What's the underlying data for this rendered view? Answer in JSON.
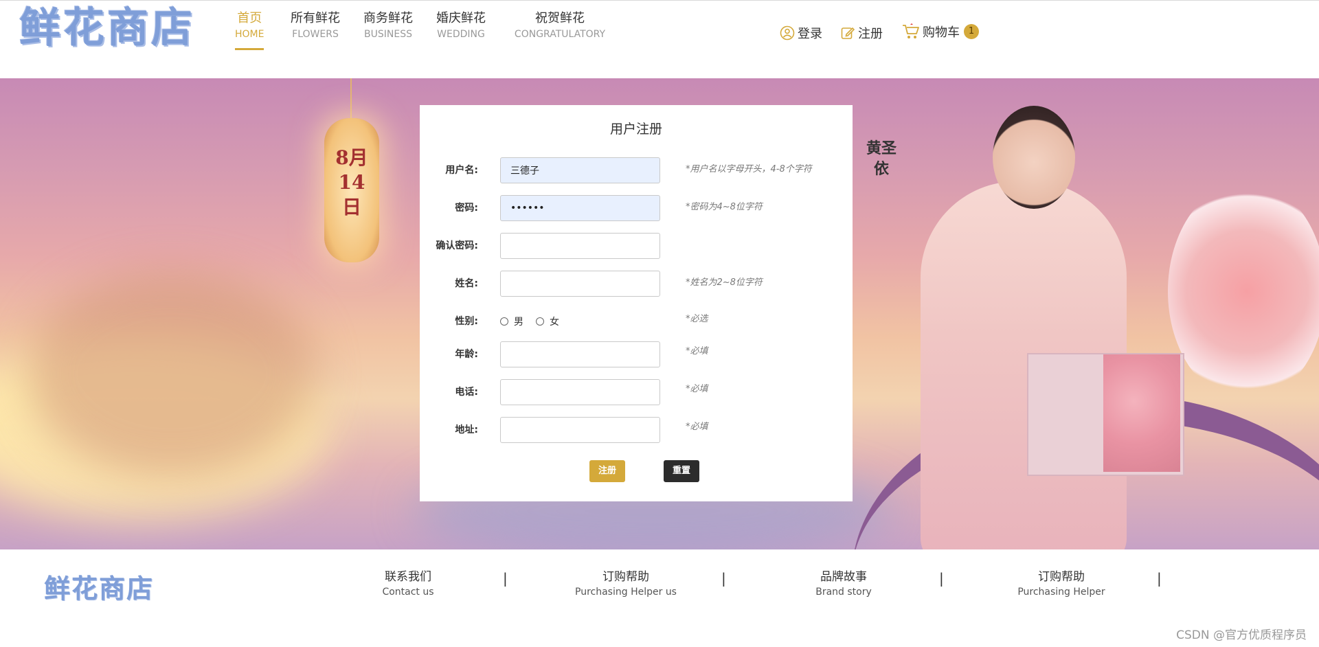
{
  "header": {
    "logo": "鲜花商店",
    "nav": [
      {
        "cn": "首页",
        "en": "HOME",
        "active": true
      },
      {
        "cn": "所有鲜花",
        "en": "FLOWERS",
        "active": false
      },
      {
        "cn": "商务鲜花",
        "en": "BUSINESS",
        "active": false
      },
      {
        "cn": "婚庆鲜花",
        "en": "WEDDING",
        "active": false
      },
      {
        "cn": "祝贺鲜花",
        "en": "CONGRATULATORY",
        "active": false
      }
    ],
    "login_label": "登录",
    "register_label": "注册",
    "cart_label": "购物车",
    "cart_count": "1"
  },
  "banner": {
    "lantern_text": "8月14日",
    "side_text": "黄圣依"
  },
  "form": {
    "title": "用户注册",
    "fields": {
      "username": {
        "label": "用户名:",
        "value": "三德子",
        "hint": "*用户名以字母开头，4-8个字符"
      },
      "password": {
        "label": "密码:",
        "value": "••••••",
        "hint": "*密码为4~8位字符"
      },
      "confirm": {
        "label": "确认密码:",
        "value": "",
        "hint": ""
      },
      "name": {
        "label": "姓名:",
        "value": "",
        "hint": "*姓名为2~8位字符"
      },
      "gender": {
        "label": "性别:",
        "options": [
          "男",
          "女"
        ],
        "hint": "*必选"
      },
      "age": {
        "label": "年龄:",
        "value": "",
        "hint": "*必填"
      },
      "phone": {
        "label": "电话:",
        "value": "",
        "hint": "*必填"
      },
      "address": {
        "label": "地址:",
        "value": "",
        "hint": "*必填"
      }
    },
    "submit_label": "注册",
    "reset_label": "重置"
  },
  "footer": {
    "logo": "鲜花商店",
    "links": [
      {
        "cn": "联系我们",
        "en": "Contact us"
      },
      {
        "cn": "订购帮助",
        "en": "Purchasing Helper us"
      },
      {
        "cn": "品牌故事",
        "en": "Brand story"
      },
      {
        "cn": "订购帮助",
        "en": "Purchasing Helper"
      }
    ],
    "separator": "|"
  },
  "watermark": "CSDN @官方优质程序员",
  "colors": {
    "accent": "#d4a93a",
    "logo": "#7f9ed8",
    "input_autofill": "#e8f0fe",
    "reset_button": "#2c2c2c"
  }
}
